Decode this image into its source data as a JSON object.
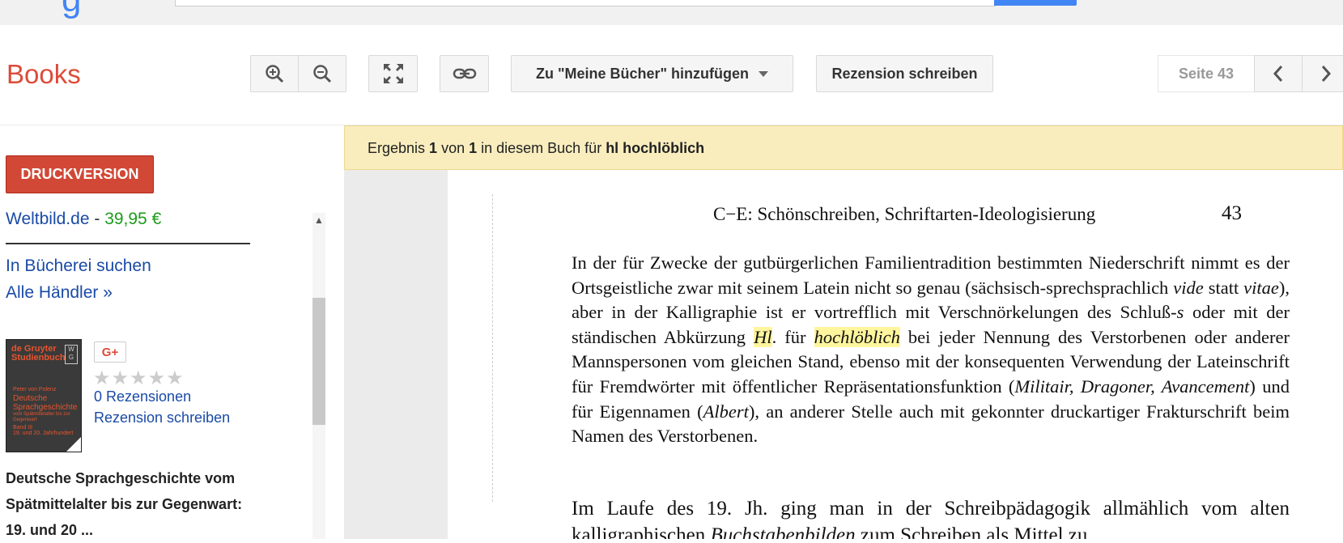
{
  "top": {
    "logo_fragment": "g"
  },
  "toolbar": {
    "brand": "Books",
    "add_to_library": "Zu \"Meine Bücher\" hinzufügen",
    "write_review": "Rezension schreiben",
    "page_indicator": "Seite 43"
  },
  "sidebar": {
    "print_button": "DRUCKVERSION",
    "seller_name": "Weltbild.de",
    "seller_sep": " - ",
    "seller_price": "39,95 €",
    "library_link": "In Bücherei suchen",
    "all_sellers_link": "Alle Händler »",
    "cover": {
      "series": "de Gruyter Studienbuch",
      "publisher_mark": "W G",
      "author": "Peter von Polenz",
      "title_line1": "Deutsche",
      "title_line2": "Sprachgeschichte",
      "subtitle": "vom Spätmittelalter bis zur Gegenwart",
      "volume": "Band III",
      "period": "19. und 20. Jahrhundert"
    },
    "gplus": "G+",
    "stars": "★★★★★",
    "reviews_count": "0 Rezensionen",
    "write_review": "Rezension schreiben",
    "book_title_1": "Deutsche Sprachgeschichte vom",
    "book_title_2": "Spätmittelalter bis zur Gegenwart:",
    "book_title_3": "19. und 20 ..."
  },
  "result": {
    "prefix": "Ergebnis ",
    "current": "1",
    "of": " von ",
    "total": "1",
    "in_book": " in diesem Buch für ",
    "query": "hl hochlöblich"
  },
  "page": {
    "running_head": "C−E: Schönschreiben, Schriftarten-Ideologisierung",
    "page_number": "43",
    "p1_a": "In der für Zwecke der gutbürgerlichen Familientradition bestimmten Niederschrift nimmt es der Ortsgeistliche zwar mit seinem Latein nicht so genau (sächsisch-sprechsprachlich ",
    "p1_vide": "vide",
    "p1_b": " statt ",
    "p1_vitae": "vitae",
    "p1_c": "), aber in der Kalligraphie ist er vortrefflich mit Verschnörkelungen des Schluß-",
    "p1_s": "s",
    "p1_d": " oder mit der ständischen Abkürzung ",
    "p1_hl": "Hl",
    "p1_e": ". für ",
    "p1_hochloeblich": "hochlöblich",
    "p1_f": " bei jeder Nennung des Verstorbenen oder anderer Mannspersonen vom gleichen Stand, ebenso mit der konsequenten Verwendung der Lateinschrift für Fremdwörter mit öffentlicher Repräsentationsfunktion (",
    "p1_mil": "Militair, Dragoner, Avancement",
    "p1_g": ") und für Eigennamen (",
    "p1_albert": "Albert",
    "p1_h": "), an anderer Stelle auch mit gekonnter druckartiger Frakturschrift beim Namen des Verstorbenen.",
    "p2_a": "Im Laufe des 19. Jh. ging man in der Schreibpädagogik allmählich vom alten kalligraphischen ",
    "p2_b": "Buchstabenbilden",
    "p2_c": " zum Schreiben als Mittel zu"
  }
}
